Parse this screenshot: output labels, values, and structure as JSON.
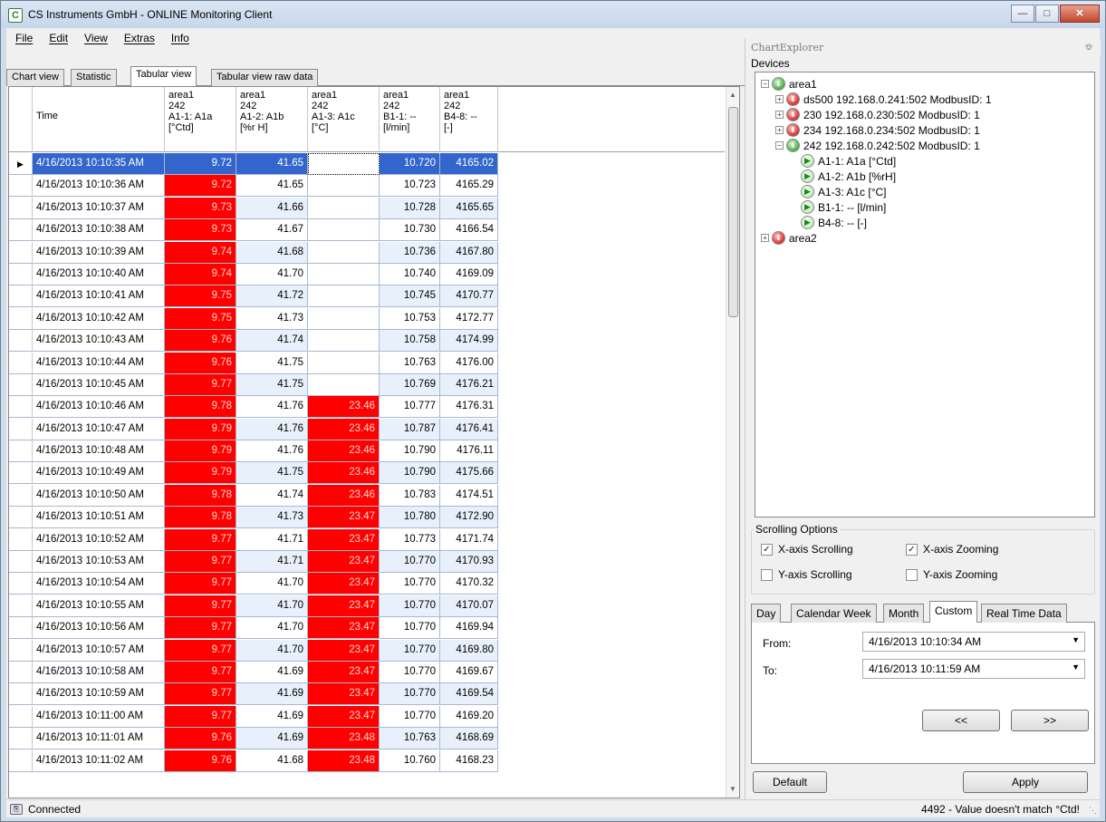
{
  "window": {
    "title": "CS Instruments GmbH - ONLINE Monitoring Client",
    "icon": "cs-logo-icon"
  },
  "menu": [
    "File",
    "Edit",
    "View",
    "Extras",
    "Info"
  ],
  "tabs": [
    "Chart view",
    "Statistic",
    "Tabular view",
    "Tabular view raw data"
  ],
  "active_tab": "Tabular view",
  "grid": {
    "columns": [
      {
        "label": "Time"
      },
      {
        "label": "area1\n242\nA1-1: A1a\n[°Ctd]"
      },
      {
        "label": "area1\n242\nA1-2: A1b\n[%r H]"
      },
      {
        "label": "area1\n242\nA1-3: A1c\n[°C]"
      },
      {
        "label": "area1\n242\nB1-1: --\n[l/min]"
      },
      {
        "label": "area1\n242\nB4-8: --\n[-]"
      }
    ],
    "rows": [
      {
        "time": "4/16/2013 10:10:35 AM",
        "v1": "9.72",
        "v2": "41.65",
        "v3": "",
        "v4": "10.720",
        "v5": "4165.02",
        "selected": true
      },
      {
        "time": "4/16/2013 10:10:36 AM",
        "v1": "9.72",
        "v2": "41.65",
        "v3": "",
        "v4": "10.723",
        "v5": "4165.29"
      },
      {
        "time": "4/16/2013 10:10:37 AM",
        "v1": "9.73",
        "v2": "41.66",
        "v3": "",
        "v4": "10.728",
        "v5": "4165.65"
      },
      {
        "time": "4/16/2013 10:10:38 AM",
        "v1": "9.73",
        "v2": "41.67",
        "v3": "",
        "v4": "10.730",
        "v5": "4166.54"
      },
      {
        "time": "4/16/2013 10:10:39 AM",
        "v1": "9.74",
        "v2": "41.68",
        "v3": "",
        "v4": "10.736",
        "v5": "4167.80"
      },
      {
        "time": "4/16/2013 10:10:40 AM",
        "v1": "9.74",
        "v2": "41.70",
        "v3": "",
        "v4": "10.740",
        "v5": "4169.09"
      },
      {
        "time": "4/16/2013 10:10:41 AM",
        "v1": "9.75",
        "v2": "41.72",
        "v3": "",
        "v4": "10.745",
        "v5": "4170.77"
      },
      {
        "time": "4/16/2013 10:10:42 AM",
        "v1": "9.75",
        "v2": "41.73",
        "v3": "",
        "v4": "10.753",
        "v5": "4172.77"
      },
      {
        "time": "4/16/2013 10:10:43 AM",
        "v1": "9.76",
        "v2": "41.74",
        "v3": "",
        "v4": "10.758",
        "v5": "4174.99"
      },
      {
        "time": "4/16/2013 10:10:44 AM",
        "v1": "9.76",
        "v2": "41.75",
        "v3": "",
        "v4": "10.763",
        "v5": "4176.00"
      },
      {
        "time": "4/16/2013 10:10:45 AM",
        "v1": "9.77",
        "v2": "41.75",
        "v3": "",
        "v4": "10.769",
        "v5": "4176.21"
      },
      {
        "time": "4/16/2013 10:10:46 AM",
        "v1": "9.78",
        "v2": "41.76",
        "v3": "23.46",
        "v4": "10.777",
        "v5": "4176.31"
      },
      {
        "time": "4/16/2013 10:10:47 AM",
        "v1": "9.79",
        "v2": "41.76",
        "v3": "23.46",
        "v4": "10.787",
        "v5": "4176.41"
      },
      {
        "time": "4/16/2013 10:10:48 AM",
        "v1": "9.79",
        "v2": "41.76",
        "v3": "23.46",
        "v4": "10.790",
        "v5": "4176.11"
      },
      {
        "time": "4/16/2013 10:10:49 AM",
        "v1": "9.79",
        "v2": "41.75",
        "v3": "23.46",
        "v4": "10.790",
        "v5": "4175.66"
      },
      {
        "time": "4/16/2013 10:10:50 AM",
        "v1": "9.78",
        "v2": "41.74",
        "v3": "23.46",
        "v4": "10.783",
        "v5": "4174.51"
      },
      {
        "time": "4/16/2013 10:10:51 AM",
        "v1": "9.78",
        "v2": "41.73",
        "v3": "23.47",
        "v4": "10.780",
        "v5": "4172.90"
      },
      {
        "time": "4/16/2013 10:10:52 AM",
        "v1": "9.77",
        "v2": "41.71",
        "v3": "23.47",
        "v4": "10.773",
        "v5": "4171.74"
      },
      {
        "time": "4/16/2013 10:10:53 AM",
        "v1": "9.77",
        "v2": "41.71",
        "v3": "23.47",
        "v4": "10.770",
        "v5": "4170.93"
      },
      {
        "time": "4/16/2013 10:10:54 AM",
        "v1": "9.77",
        "v2": "41.70",
        "v3": "23.47",
        "v4": "10.770",
        "v5": "4170.32"
      },
      {
        "time": "4/16/2013 10:10:55 AM",
        "v1": "9.77",
        "v2": "41.70",
        "v3": "23.47",
        "v4": "10.770",
        "v5": "4170.07"
      },
      {
        "time": "4/16/2013 10:10:56 AM",
        "v1": "9.77",
        "v2": "41.70",
        "v3": "23.47",
        "v4": "10.770",
        "v5": "4169.94"
      },
      {
        "time": "4/16/2013 10:10:57 AM",
        "v1": "9.77",
        "v2": "41.70",
        "v3": "23.47",
        "v4": "10.770",
        "v5": "4169.80"
      },
      {
        "time": "4/16/2013 10:10:58 AM",
        "v1": "9.77",
        "v2": "41.69",
        "v3": "23.47",
        "v4": "10.770",
        "v5": "4169.67"
      },
      {
        "time": "4/16/2013 10:10:59 AM",
        "v1": "9.77",
        "v2": "41.69",
        "v3": "23.47",
        "v4": "10.770",
        "v5": "4169.54"
      },
      {
        "time": "4/16/2013 10:11:00 AM",
        "v1": "9.77",
        "v2": "41.69",
        "v3": "23.47",
        "v4": "10.770",
        "v5": "4169.20"
      },
      {
        "time": "4/16/2013 10:11:01 AM",
        "v1": "9.76",
        "v2": "41.69",
        "v3": "23.48",
        "v4": "10.763",
        "v5": "4168.69"
      },
      {
        "time": "4/16/2013 10:11:02 AM",
        "v1": "9.76",
        "v2": "41.68",
        "v3": "23.48",
        "v4": "10.760",
        "v5": "4168.23"
      }
    ]
  },
  "chart_explorer": {
    "title": "ChartExplorer",
    "devices_label": "Devices",
    "tree": [
      {
        "label": "area1",
        "level": 0,
        "expander": "minus",
        "status": "green"
      },
      {
        "label": "ds500 192.168.0.241:502 ModbusID: 1",
        "level": 1,
        "expander": "plus",
        "status": "red"
      },
      {
        "label": "230 192.168.0.230:502 ModbusID: 1",
        "level": 1,
        "expander": "plus",
        "status": "red"
      },
      {
        "label": "234 192.168.0.234:502 ModbusID: 1",
        "level": 1,
        "expander": "plus",
        "status": "red"
      },
      {
        "label": "242 192.168.0.242:502 ModbusID: 1",
        "level": 1,
        "expander": "minus",
        "status": "green"
      },
      {
        "label": "A1-1: A1a [°Ctd]",
        "level": 2,
        "expander": "none",
        "status": "play"
      },
      {
        "label": "A1-2: A1b [%rH]",
        "level": 2,
        "expander": "none",
        "status": "play"
      },
      {
        "label": "A1-3: A1c [°C]",
        "level": 2,
        "expander": "none",
        "status": "play"
      },
      {
        "label": "B1-1: -- [l/min]",
        "level": 2,
        "expander": "none",
        "status": "play"
      },
      {
        "label": "B4-8: -- [-]",
        "level": 2,
        "expander": "none",
        "status": "play"
      },
      {
        "label": "area2",
        "level": 0,
        "expander": "plus",
        "status": "red"
      }
    ],
    "scrolling_options": {
      "legend": "Scrolling Options",
      "x_scroll": {
        "label": "X-axis Scrolling",
        "checked": true
      },
      "x_zoom": {
        "label": "X-axis Zooming",
        "checked": true
      },
      "y_scroll": {
        "label": "Y-axis Scrolling",
        "checked": false
      },
      "y_zoom": {
        "label": "Y-axis Zooming",
        "checked": false
      }
    },
    "range_tabs": [
      "Day",
      "Calendar Week",
      "Month",
      "Custom",
      "Real Time Data"
    ],
    "active_range_tab": "Custom",
    "from_label": "From:",
    "from_value": "4/16/2013 10:10:34 AM",
    "to_label": "To:",
    "to_value": "4/16/2013 10:11:59 AM",
    "prev_label": "<<",
    "next_label": ">>",
    "default_label": "Default",
    "apply_label": "Apply"
  },
  "status": {
    "left": "Connected",
    "right": "4492 - Value doesn't match °Ctd!"
  },
  "colors": {
    "alarm_red": "#ff0000",
    "selection_blue": "#3366cc",
    "alt_row_blue": "#e8f1fb"
  }
}
